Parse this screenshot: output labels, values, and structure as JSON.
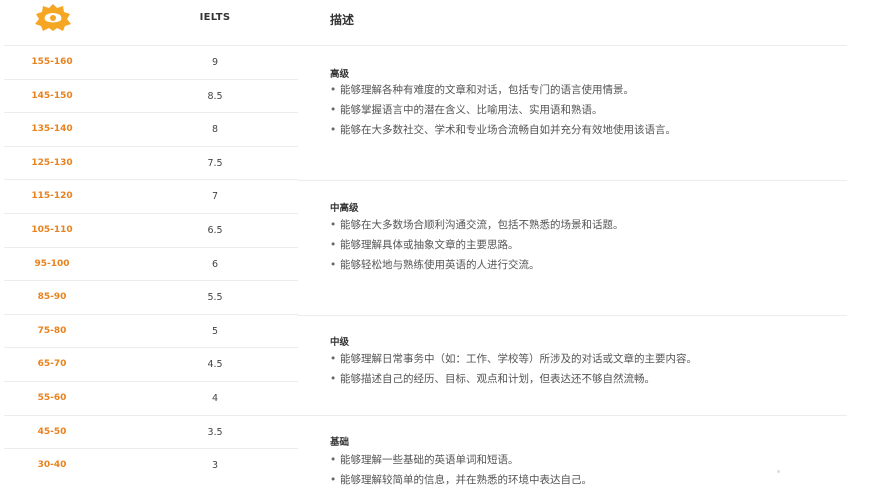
{
  "header": {
    "col_ielts": "IELTS",
    "col_desc": "描述"
  },
  "rows": [
    {
      "score": "155-160",
      "ielts": "9"
    },
    {
      "score": "145-150",
      "ielts": "8.5"
    },
    {
      "score": "135-140",
      "ielts": "8"
    },
    {
      "score": "125-130",
      "ielts": "7.5"
    },
    {
      "score": "115-120",
      "ielts": "7"
    },
    {
      "score": "105-110",
      "ielts": "6.5"
    },
    {
      "score": "95-100",
      "ielts": "6"
    },
    {
      "score": "85-90",
      "ielts": "5.5"
    },
    {
      "score": "75-80",
      "ielts": "5"
    },
    {
      "score": "65-70",
      "ielts": "4.5"
    },
    {
      "score": "55-60",
      "ielts": "4"
    },
    {
      "score": "45-50",
      "ielts": "3.5"
    },
    {
      "score": "30-40",
      "ielts": "3"
    }
  ],
  "levels": [
    {
      "title": "高级",
      "items": [
        "能够理解各种有难度的文章和对话，包括专门的语言使用情景。",
        "能够掌握语言中的潜在含义、比喻用法、实用语和熟语。",
        "能够在大多数社交、学术和专业场合流畅自如并充分有效地使用该语言。"
      ]
    },
    {
      "title": "中高级",
      "items": [
        "能够在大多数场合顺利沟通交流，包括不熟悉的场景和话题。",
        "能够理解具体或抽象文章的主要思路。",
        "能够轻松地与熟练使用英语的人进行交流。"
      ]
    },
    {
      "title": "中级",
      "items": [
        "能够理解日常事务中（如：工作、学校等）所涉及的对话或文章的主要内容。",
        "能够描述自己的经历、目标、观点和计划，但表达还不够自然流畅。"
      ]
    },
    {
      "title": "基础",
      "items": [
        "能够理解一些基础的英语单词和短语。",
        "能够理解较简单的信息，并在熟悉的环境中表达自己。"
      ]
    }
  ],
  "colors": {
    "accent": "#e8821e",
    "logo": "#f5a623"
  }
}
